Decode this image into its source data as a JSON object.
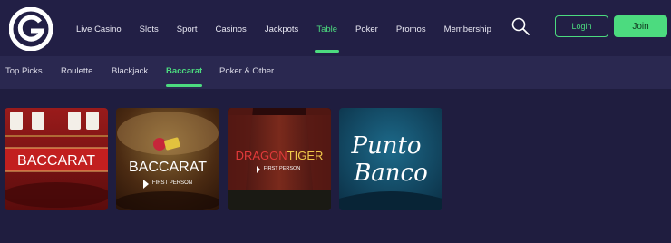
{
  "brand": {
    "logo_icon": "g-logo-icon"
  },
  "main_nav": [
    {
      "label": "Live Casino",
      "active": false
    },
    {
      "label": "Slots",
      "active": false
    },
    {
      "label": "Sport",
      "active": false
    },
    {
      "label": "Casinos",
      "active": false
    },
    {
      "label": "Jackpots",
      "active": false
    },
    {
      "label": "Table",
      "active": true
    },
    {
      "label": "Poker",
      "active": false
    },
    {
      "label": "Promos",
      "active": false
    },
    {
      "label": "Membership",
      "active": false
    }
  ],
  "header": {
    "search_icon": "search-icon",
    "login_label": "Login",
    "join_label": "Join"
  },
  "sub_nav": [
    {
      "label": "Top Picks",
      "active": false
    },
    {
      "label": "Roulette",
      "active": false
    },
    {
      "label": "Blackjack",
      "active": false
    },
    {
      "label": "Baccarat",
      "active": true
    },
    {
      "label": "Poker & Other",
      "active": false
    }
  ],
  "games": [
    {
      "title": "BACCARAT"
    },
    {
      "title": "BACCARAT",
      "subtitle": "FIRST PERSON"
    },
    {
      "title_a": "DRAGON",
      "title_b": "TIGER",
      "subtitle": "FIRST PERSON"
    },
    {
      "title_a": "Punto",
      "title_b": "Banco"
    }
  ],
  "colors": {
    "accent": "#4cdb7f",
    "background": "#1f1d3f",
    "header": "#221f45",
    "subheader": "#2a2850"
  }
}
